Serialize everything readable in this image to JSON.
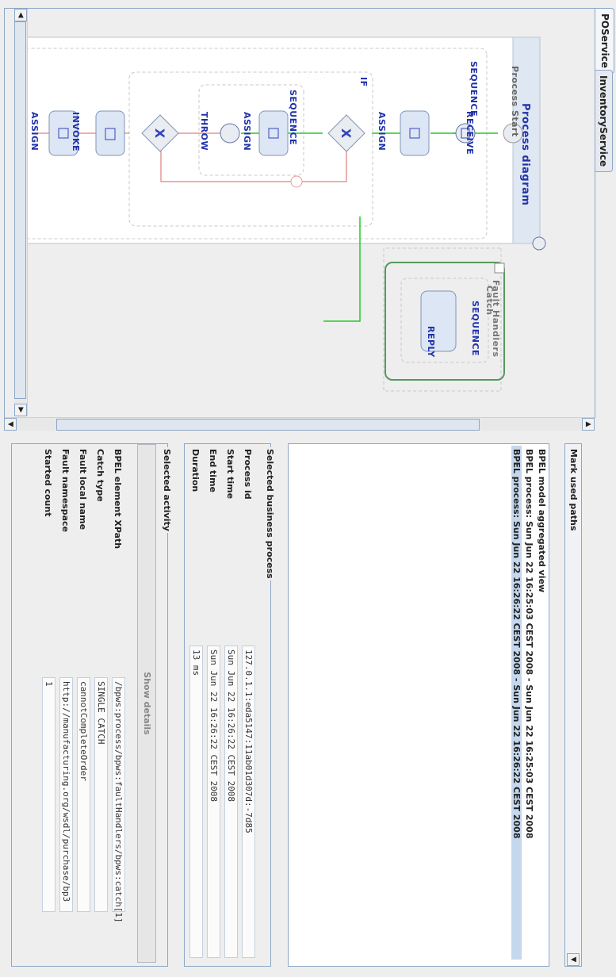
{
  "tabs": [
    "POService",
    "InventoryService"
  ],
  "diagram": {
    "title": "Process diagram",
    "process_start": "Process Start",
    "sequence": "SEQUENCE",
    "receive": "RECEIVE",
    "assign": "ASSIGN",
    "if": "IF",
    "inner_sequence": "SEQUENCE",
    "inner_assign": "ASSIGN",
    "throw": "THROW",
    "invoke": "INVOKE",
    "assign_end": "ASSIGN",
    "fault_handlers": "Fault Handlers",
    "catch": "Catch",
    "catch_sequence": "SEQUENCE",
    "reply": "REPLY",
    "colors": {
      "accent": "#3344bb",
      "flow_active": "#22cc22",
      "flow_inactive": "#e08080",
      "catch_border": "#55995e"
    }
  },
  "paths": {
    "header": "Mark used paths",
    "items": [
      "BPEL model aggregated view",
      "BPEL process: Sun Jun 22 16:25:03 CEST 2008 - Sun Jun 22 16:25:03 CEST 2008",
      "BPEL process: Sun Jun 22 16:26:22 CEST 2008 - Sun Jun 22 16:26:22 CEST 2008"
    ]
  },
  "business": {
    "title": "Selected business process",
    "rows": [
      {
        "label": "Process id",
        "value": "127.0.1.1:eda5147:11ab01d307d:-7d85"
      },
      {
        "label": "Start time",
        "value": "Sun Jun 22 16:26:22 CEST 2008"
      },
      {
        "label": "End time",
        "value": "Sun Jun 22 16:26:22 CEST 2008"
      },
      {
        "label": "Duration",
        "value": "13 ms"
      }
    ]
  },
  "activity": {
    "title": "Selected activity",
    "show_details": "Show details",
    "rows": [
      {
        "label": "BPEL element XPath",
        "value": "/bpws:process/bpws:faultHandlers/bpws:catch[1]"
      },
      {
        "label": "Catch type",
        "value": "SINGLE CATCH"
      },
      {
        "label": "Fault local name",
        "value": "cannotCompleteOrder"
      },
      {
        "label": "Fault namespace",
        "value": "http://manufacturing.org/wsdl/purchase/bp3"
      },
      {
        "label": "Started count",
        "value": "1"
      }
    ]
  }
}
